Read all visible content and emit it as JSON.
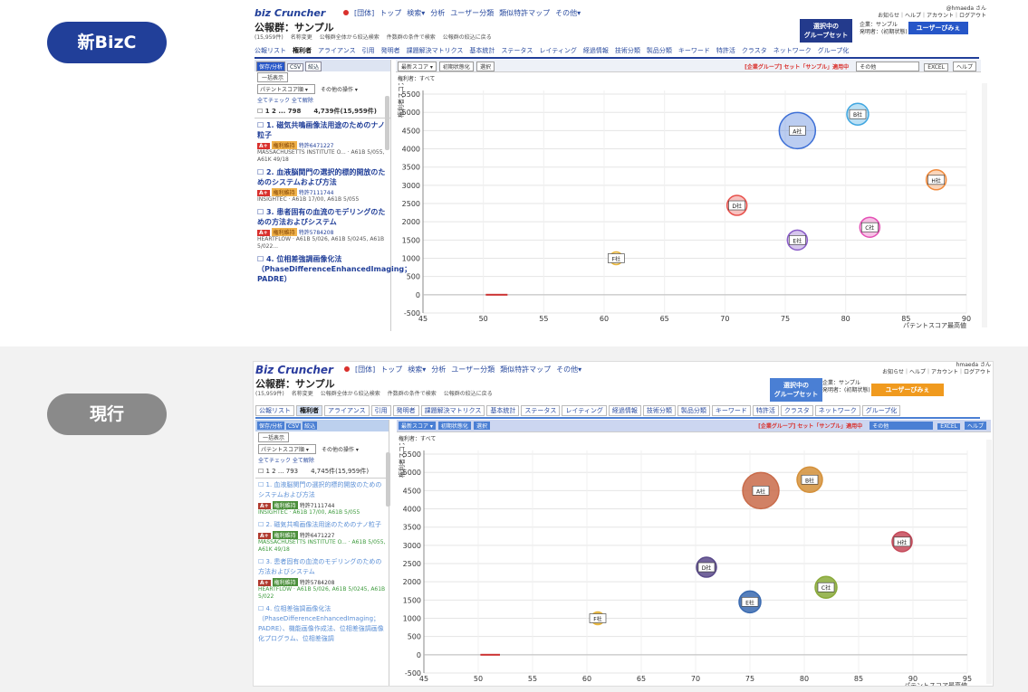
{
  "labels": {
    "new": "新BizC",
    "current": "現行"
  },
  "new": {
    "logo": "biz Cruncher",
    "topnav": [
      "[団体]",
      "トップ",
      "検索▾",
      "分析",
      "ユーザー分類",
      "類似特許マップ",
      "その他▾"
    ],
    "user": [
      "@hmaeda さん",
      "お知らせ｜ヘルプ｜アカウント｜ログアウト"
    ],
    "portfolio_name": "公報群：サンプル",
    "portfolio_sub": [
      "(15,959件)",
      "名称変更",
      "公報群全体から絞込検索",
      "件数群の条件で検索",
      "公報群の絞込に戻る"
    ],
    "group_button": [
      "選択中の",
      "グループセット"
    ],
    "corp": [
      "企業：サンプル",
      "発明者：(初期状態)"
    ],
    "user_button": "ユーザーびみぇ",
    "menu": [
      "公報リスト",
      "権利者",
      "アライアンス",
      "引用",
      "発明者",
      "課題解決マトリクス",
      "基本統計",
      "ステータス",
      "レイティング",
      "経過情報",
      "技術分類",
      "製品分類",
      "キーワード",
      "特許活",
      "クラスタ",
      "ネットワーク",
      "グループ化"
    ],
    "menu_active": 1,
    "sidebar": {
      "tools": [
        "保存/分析",
        "CSV",
        "絞込"
      ],
      "display_btn": "一括表示",
      "sort_select": "パテントスコア順 ▾",
      "ops_select": "その他の操作 ▾",
      "check_all": "全てチェック 全て解除",
      "pages": "☐ 1 2 ... 798",
      "count": "4,739件(15,959件)",
      "items": [
        {
          "title": "☐ 1. 磁気共鳴画像法用途のためのナノ粒子",
          "rank": "A+",
          "status": "権利維持",
          "num": "特許6471227",
          "assignee": "MASSACHUSETTS INSTITUTE O... · A61B 5/055, A61K 49/18"
        },
        {
          "title": "☐ 2. 血液脳関門の選択的標的開放のためのシステムおよび方法",
          "rank": "A+",
          "status": "権利維持",
          "num": "特許7111744",
          "assignee": "INSIGHTEC · A61B 17/00, A61B 5/055"
        },
        {
          "title": "☐ 3. 患者固有の血流のモデリングのための方法およびシステム",
          "rank": "A+",
          "status": "権利維持",
          "num": "特許5784208",
          "assignee": "HEARTFLOW · A61B 5/026, A61B 5/0245, A61B 5/022..."
        },
        {
          "title": "☐ 4. 位相差強調画像化法（PhaseDifferenceEnhancedImaging；PADRE）",
          "rank": "",
          "status": "",
          "num": "",
          "assignee": ""
        }
      ]
    },
    "chart_bar": {
      "score_select": "最新スコア ▾",
      "btns": [
        "初期状態化",
        "選択"
      ],
      "group": "[企業グループ] セット「サンプル」適用中",
      "other": "その他",
      "excel": "EXCEL",
      "help": "ヘルプ"
    },
    "filter": "権利者：すべて"
  },
  "current": {
    "logo": "Biz Cruncher",
    "topnav": [
      "[団体]",
      "トップ",
      "検索▾",
      "分析",
      "ユーザー分類",
      "類似特許マップ",
      "その他▾"
    ],
    "user": [
      "hmaeda さん",
      "お知らせ｜ヘルプ｜アカウント｜ログアウト"
    ],
    "portfolio_name": "公報群：サンプル",
    "portfolio_sub": [
      "(15,959件)",
      "名称変更",
      "公報群全体から絞込検索",
      "件数群の条件で検索",
      "公報群の絞込に戻る"
    ],
    "group_button": [
      "選択中の",
      "グループセット"
    ],
    "corp": [
      "企業：サンプル",
      "発明者：(初期状態)"
    ],
    "user_button": "ユーザーびみぇ",
    "menu": [
      "公報リスト",
      "権利者",
      "アライアンス",
      "引用",
      "発明者",
      "課題解決マトリクス",
      "基本統計",
      "ステータス",
      "レイティング",
      "経過情報",
      "技術分類",
      "製品分類",
      "キーワード",
      "特許活",
      "クラスタ",
      "ネットワーク",
      "グループ化"
    ],
    "menu_active": 1,
    "sidebar": {
      "tools": [
        "保存/分析",
        "CSV",
        "絞込"
      ],
      "display_btn": "一括表示",
      "sort_select": "パテントスコア順 ▾",
      "ops_select": "その他の操作 ▾",
      "check_all": "全てチェック 全て解除",
      "pages": "☐ 1 2 ... 793",
      "count": "4,745件(15,959件)",
      "items": [
        {
          "title": "☐ 1. 血液脳関門の選択的標的開放のためのシステムおよび方法",
          "rank": "A+",
          "status": "権利維持",
          "num": "特許7111744",
          "assignee": "INSIGHTEC · A61B 17/00, A61B 5/055"
        },
        {
          "title": "☐ 2. 磁気共鳴画像法用途のためのナノ粒子",
          "rank": "A+",
          "status": "権利維持",
          "num": "特許6471227",
          "assignee": "MASSACHUSETTS INSTITUTE O... · A61B 5/055, A61K 49/18"
        },
        {
          "title": "☐ 3. 患者固有の血流のモデリングのための方法およびシステム",
          "rank": "A+",
          "status": "権利維持",
          "num": "特許5784208",
          "assignee": "HEARTFLOW · A61B 5/026, A61B 5/0245, A61B 5/022"
        },
        {
          "title": "☐ 4. 位相差強調画像化法（PhaseDifferenceEnhancedImaging；PADRE）、機能画像作成法、位相差強調画像化プログラム、位相差強調",
          "rank": "",
          "status": "",
          "num": "",
          "assignee": ""
        }
      ]
    },
    "chart_bar": {
      "score_select": "最新スコア ▾",
      "btns": [
        "初期状態化",
        "選択"
      ],
      "group": "[企業グループ] セット「サンプル」適用中",
      "other": "その他",
      "excel": "EXCEL",
      "help": "ヘルプ"
    },
    "filter": "権利者：すべて"
  },
  "chart_data": [
    {
      "type": "scatter",
      "xlabel": "パテントスコア最高値",
      "ylabel": "権利者スコア",
      "xticks": [
        45,
        50,
        55,
        60,
        65,
        70,
        75,
        80,
        85,
        90
      ],
      "yticks": [
        -500,
        0,
        500,
        1000,
        1500,
        2000,
        2500,
        3000,
        3500,
        4000,
        4500,
        5000,
        5500
      ],
      "xlim": [
        45,
        90
      ],
      "ylim": [
        -500,
        5600
      ],
      "bubbles": [
        {
          "label": "A社",
          "x": 76,
          "y": 4500,
          "r": 20,
          "color": "#3d6fd6"
        },
        {
          "label": "B社",
          "x": 81,
          "y": 4950,
          "r": 12,
          "color": "#3fa6e0"
        },
        {
          "label": "H社",
          "x": 87.5,
          "y": 3150,
          "r": 11,
          "color": "#f08a3c"
        },
        {
          "label": "D社",
          "x": 71,
          "y": 2450,
          "r": 11,
          "color": "#e8504b"
        },
        {
          "label": "C社",
          "x": 82,
          "y": 1850,
          "r": 11,
          "color": "#e44fb5"
        },
        {
          "label": "E社",
          "x": 76,
          "y": 1500,
          "r": 11,
          "color": "#8a5cc8"
        },
        {
          "label": "F社",
          "x": 61,
          "y": 1000,
          "r": 7,
          "color": "#e8b53a"
        }
      ]
    },
    {
      "type": "scatter",
      "xlabel": "パテントスコア最高値",
      "ylabel": "権利者スコア",
      "xticks": [
        45,
        50,
        55,
        60,
        65,
        70,
        75,
        80,
        85,
        90,
        95
      ],
      "yticks": [
        -500,
        0,
        500,
        1000,
        1500,
        2000,
        2500,
        3000,
        3500,
        4000,
        4500,
        5000,
        5500
      ],
      "xlim": [
        45,
        95
      ],
      "ylim": [
        -500,
        5600
      ],
      "bubbles": [
        {
          "label": "A社",
          "x": 76,
          "y": 4500,
          "r": 20,
          "color": "#c96b4a"
        },
        {
          "label": "B社",
          "x": 80.5,
          "y": 4800,
          "r": 14,
          "color": "#d4903a"
        },
        {
          "label": "H社",
          "x": 89,
          "y": 3100,
          "r": 11,
          "color": "#c54a5a"
        },
        {
          "label": "D社",
          "x": 71,
          "y": 2400,
          "r": 11,
          "color": "#5a4a8a"
        },
        {
          "label": "C社",
          "x": 82,
          "y": 1850,
          "r": 12,
          "color": "#8aaa3a"
        },
        {
          "label": "E社",
          "x": 75,
          "y": 1450,
          "r": 12,
          "color": "#3a6ab0"
        },
        {
          "label": "F社",
          "x": 61,
          "y": 1000,
          "r": 7,
          "color": "#e8b53a"
        }
      ]
    }
  ]
}
